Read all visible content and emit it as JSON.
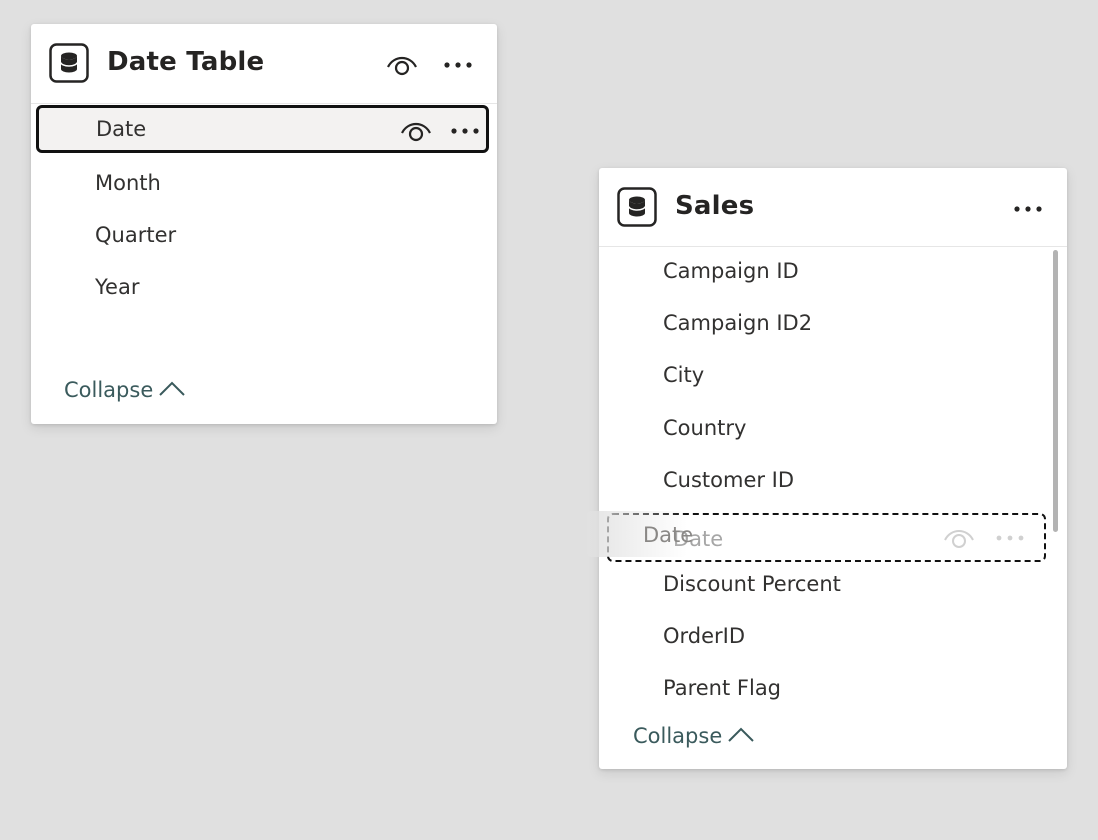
{
  "tables": {
    "date_table": {
      "title": "Date Table",
      "icon": "database-icon",
      "header_actions": [
        "eye-icon",
        "more-icon"
      ],
      "fields": [
        {
          "label": "Date",
          "selected": true
        },
        {
          "label": "Month"
        },
        {
          "label": "Quarter"
        },
        {
          "label": "Year"
        }
      ],
      "collapse_label": "Collapse"
    },
    "sales": {
      "title": "Sales",
      "icon": "database-icon",
      "header_actions": [
        "more-icon"
      ],
      "fields": [
        {
          "label": "Campaign ID"
        },
        {
          "label": "Campaign ID2"
        },
        {
          "label": "City"
        },
        {
          "label": "Country"
        },
        {
          "label": "Customer ID"
        },
        {
          "label": "Date",
          "drop_target": true
        },
        {
          "label": "Discount Percent"
        },
        {
          "label": "OrderID"
        },
        {
          "label": "Parent Flag"
        }
      ],
      "collapse_label": "Collapse"
    }
  },
  "drag_ghost": {
    "label": "Date"
  },
  "colors": {
    "canvas": "#e0e0e0",
    "card": "#ffffff",
    "collapse_link": "#3a5a5c",
    "selected_row_bg": "#f3f2f1",
    "selection_border": "#111111"
  }
}
